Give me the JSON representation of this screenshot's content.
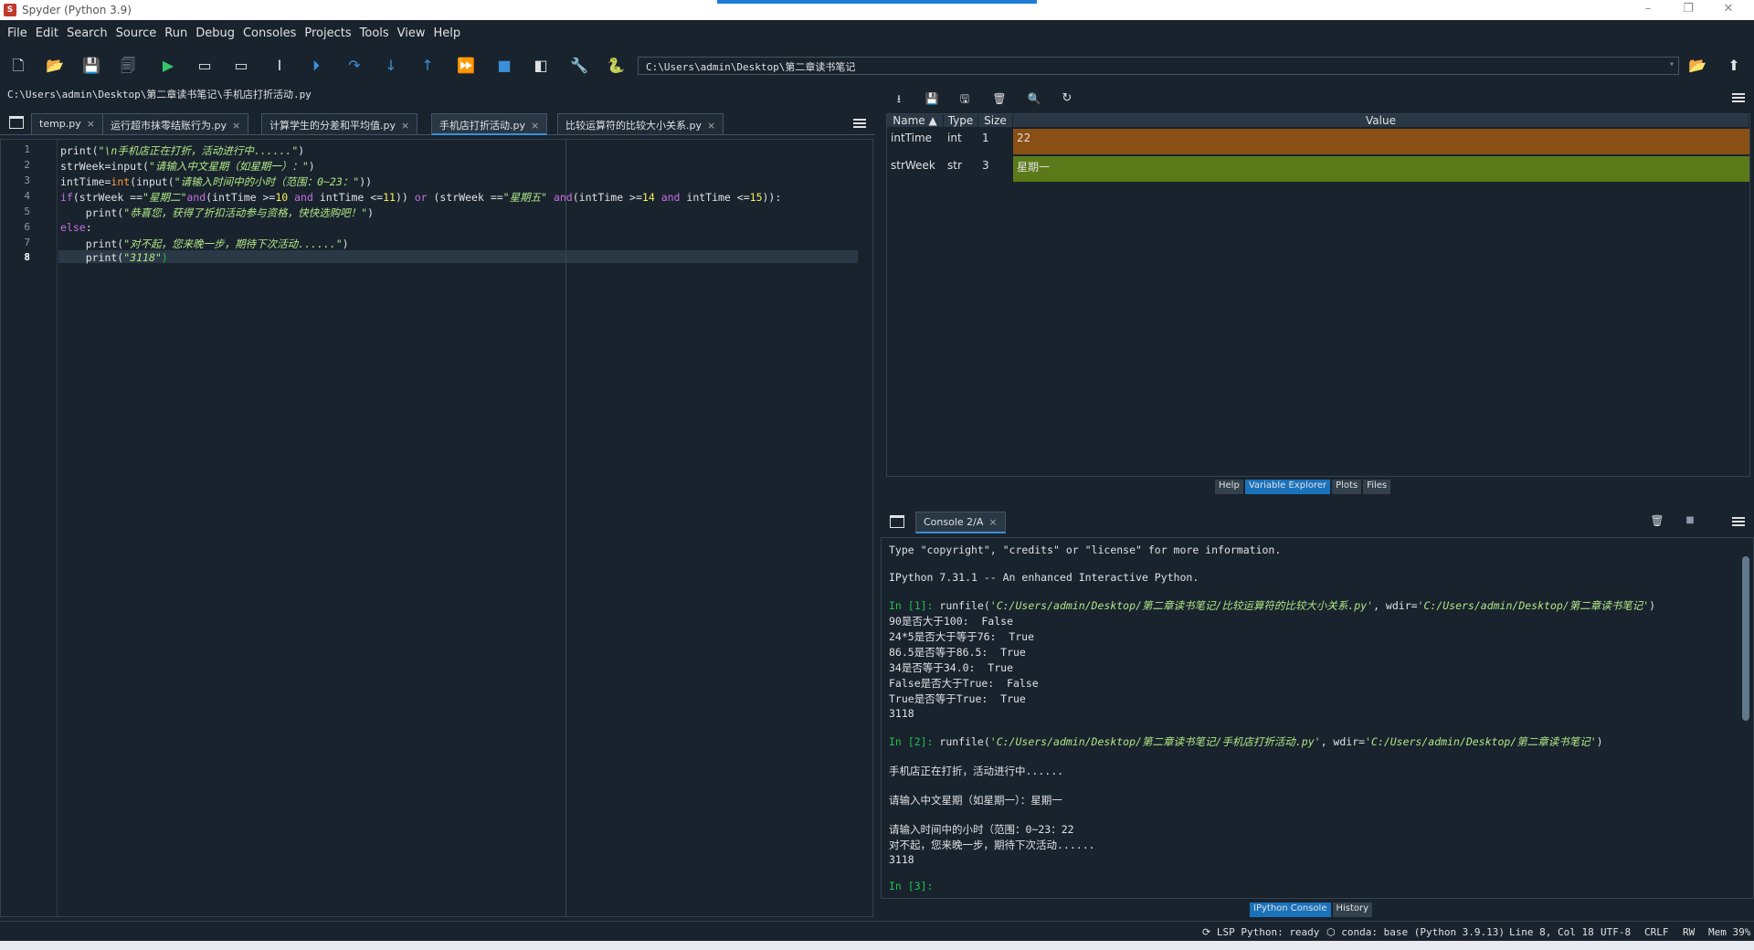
{
  "window": {
    "title": "Spyder (Python 3.9)",
    "app_icon": "spyder-icon"
  },
  "menu": [
    "File",
    "Edit",
    "Search",
    "Source",
    "Run",
    "Debug",
    "Consoles",
    "Projects",
    "Tools",
    "View",
    "Help"
  ],
  "toolbar": {
    "path": "C:\\Users\\admin\\Desktop\\第二章读书笔记",
    "icons": [
      "new-file-icon",
      "open-file-icon",
      "save-icon",
      "save-all-icon",
      "run-icon",
      "run-cell-icon",
      "run-cell-advance-icon",
      "run-selection-icon",
      "debug-icon",
      "step-over-icon",
      "step-into-icon",
      "step-return-icon",
      "continue-icon",
      "stop-icon",
      "maximize-pane-icon",
      "preferences-icon",
      "python-path-icon"
    ]
  },
  "editor": {
    "file_path": "C:\\Users\\admin\\Desktop\\第二章读书笔记\\手机店打折活动.py",
    "tabs": [
      {
        "label": "temp.py"
      },
      {
        "label": "运行超市抹零结账行为.py"
      },
      {
        "label": "计算学生的分差和平均值.py"
      },
      {
        "label": "手机店打折活动.py"
      },
      {
        "label": "比较运算符的比较大小关系.py"
      }
    ],
    "line_numbers": [
      "1",
      "2",
      "3",
      "4",
      "5",
      "6",
      "7",
      "8"
    ],
    "lines": {
      "l1a": "print(",
      "l1b": "\"\\n手机店正在打折，活动进行中......\"",
      "l1c": ")",
      "l2a": "strWeek=input(",
      "l2b": "\"请输入中文星期（如星期一）：\"",
      "l2c": ")",
      "l3a": "intTime=",
      "l3b": "int",
      "l3c": "(input(",
      "l3d": "\"请输入时间中的小时（范围：0~23：\"",
      "l3e": "))",
      "l4a": "if",
      "l4b": "(strWeek ==",
      "l4c": "\"星期二\"",
      "l4d": "and",
      "l4e": "(intTime >=",
      "l4f": "10",
      "l4g": " and ",
      "l4h": "intTime <=",
      "l4i": "11",
      "l4j": ")) ",
      "l4k": "or",
      "l4l": " (strWeek ==",
      "l4m": "\"星期五\"",
      "l4n": " and",
      "l4o": "(intTime >=",
      "l4p": "14",
      "l4q": " and ",
      "l4r": "intTime <=",
      "l4s": "15",
      "l4t": ")):",
      "l5a": "    print(",
      "l5b": "\"恭喜您，获得了折扣活动参与资格，快快选购吧！\"",
      "l5c": ")",
      "l6a": "else",
      "l6b": ":",
      "l7a": "    print(",
      "l7b": "\"对不起，您来晚一步，期待下次活动......\"",
      "l7c": ")",
      "l8a": "    print(",
      "l8b": "\"3118\"",
      "l8c": ")"
    }
  },
  "variable_explorer": {
    "headers": {
      "name": "Name",
      "type": "Type",
      "size": "Size",
      "value": "Value"
    },
    "rows": [
      {
        "name": "intTime",
        "type": "int",
        "size": "1",
        "value": "22",
        "color": "#8a4f14"
      },
      {
        "name": "strWeek",
        "type": "str",
        "size": "3",
        "value": "星期一",
        "color": "#5a7a1a"
      }
    ],
    "tabs": [
      "Help",
      "Variable Explorer",
      "Plots",
      "Files"
    ]
  },
  "console": {
    "tab": "Console 2/A",
    "lines": {
      "c1": "Type \"copyright\", \"credits\" or \"license\" for more information.",
      "c2": "IPython 7.31.1 -- An enhanced Interactive Python.",
      "c3p": "In [1]: ",
      "c3a": "runfile(",
      "c3b": "'C:/Users/admin/Desktop/第二章读书笔记/比较运算符的比较大小关系.py'",
      "c3c": ", wdir=",
      "c3d": "'C:/Users/admin/Desktop/第二章读书笔记'",
      "c3e": ")",
      "c4": "90是否大于100:  False",
      "c5": "24*5是否大于等于76:  True",
      "c6": "86.5是否等于86.5:  True",
      "c7": "34是否等于34.0:  True",
      "c8": "False是否大于True:  False",
      "c9": "True是否等于True:  True",
      "c10": "3118",
      "c11p": "In [2]: ",
      "c11a": "runfile(",
      "c11b": "'C:/Users/admin/Desktop/第二章读书笔记/手机店打折活动.py'",
      "c11c": ", wdir=",
      "c11d": "'C:/Users/admin/Desktop/第二章读书笔记'",
      "c11e": ")",
      "c12": "手机店正在打折，活动进行中......",
      "c13": "请输入中文星期（如星期一）：星期一",
      "c14": "请输入时间中的小时（范围：0~23：22",
      "c15": "对不起，您来晚一步，期待下次活动......",
      "c16": "3118",
      "c17p": "In [3]: "
    },
    "tabs": [
      "IPython Console",
      "History"
    ]
  },
  "status": {
    "lsp": "LSP Python: ready",
    "conda": "conda: base (Python 3.9.13)",
    "position": "Line 8, Col 18",
    "encoding": "UTF-8",
    "eol": "CRLF",
    "rw": "RW",
    "mem": "Mem 39%"
  }
}
